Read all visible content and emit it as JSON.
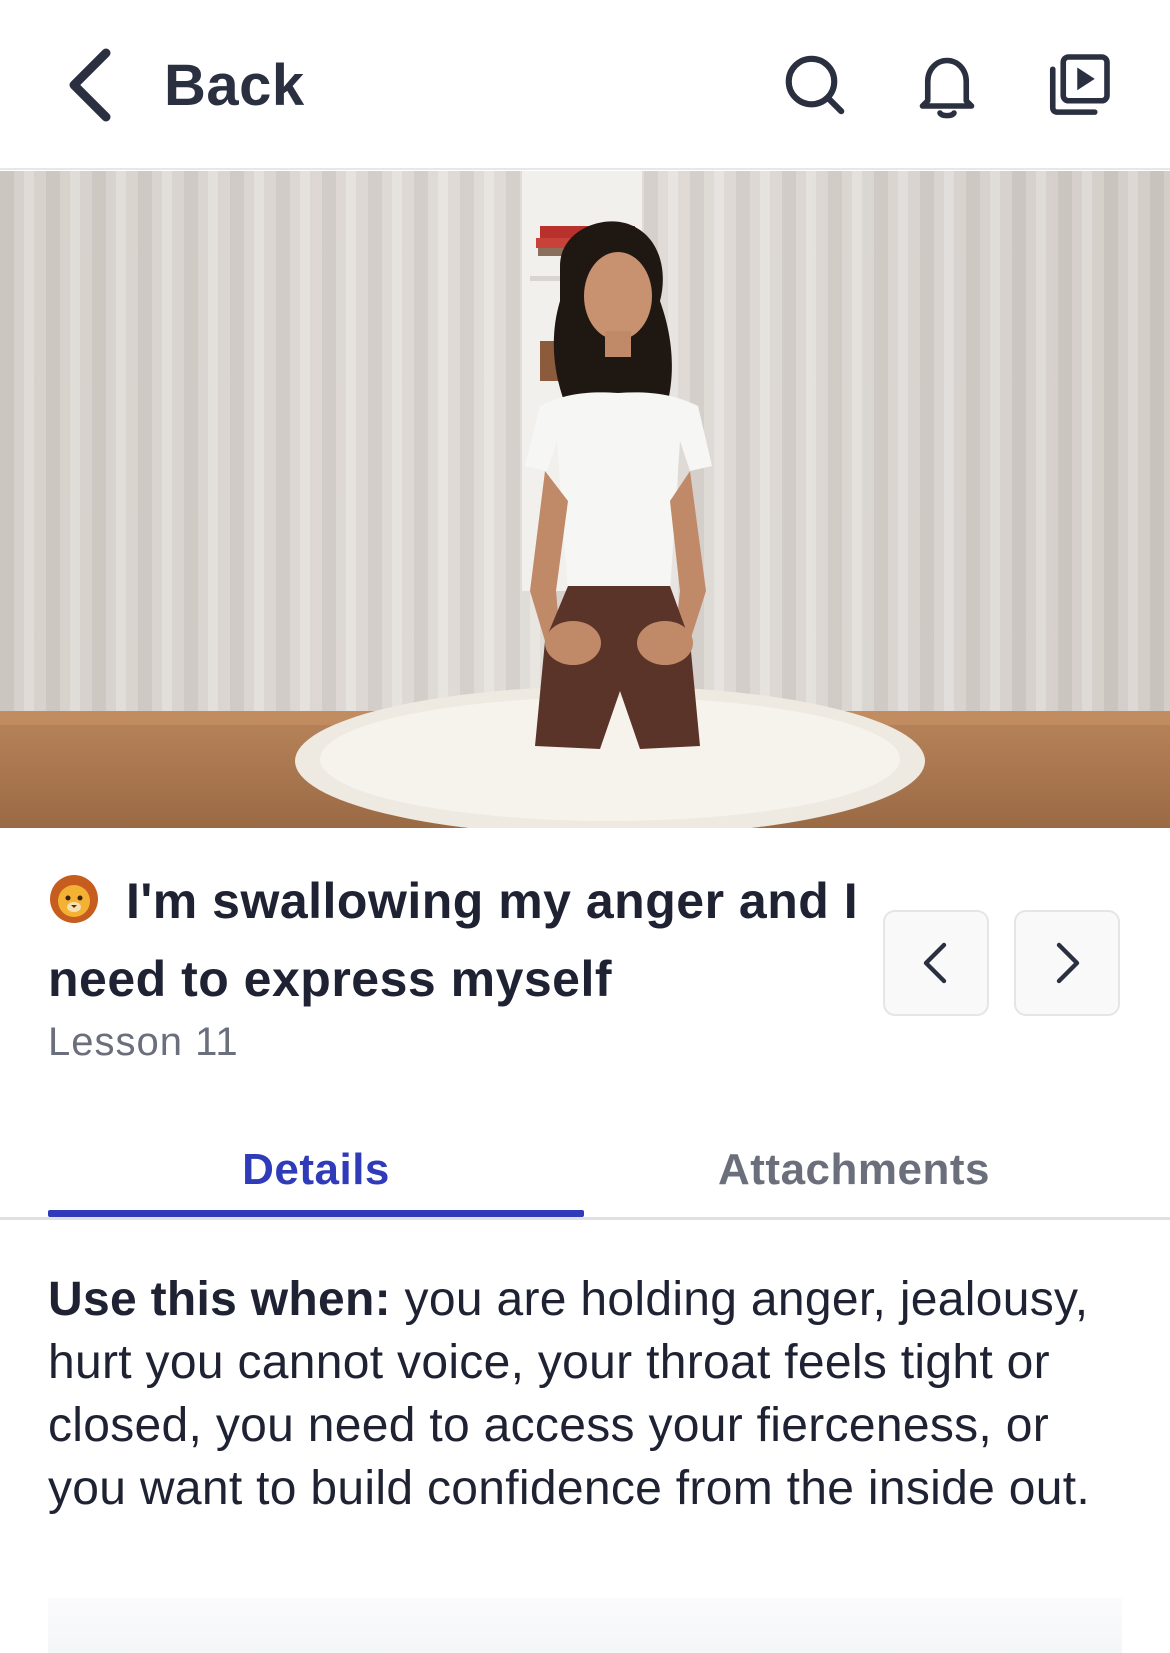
{
  "header": {
    "back_label": "Back",
    "icons": [
      "search-icon",
      "bell-icon",
      "video-library-icon"
    ]
  },
  "lesson": {
    "emoji": "lion-face",
    "title": "I'm swallowing my anger and I need to express myself",
    "number_label": "Lesson 11"
  },
  "tabs": {
    "details": "Details",
    "attachments": "Attachments",
    "active": "Details"
  },
  "details": {
    "lead": "Use this when:",
    "text": " you are holding anger, jealousy, hurt you cannot voice, your throat feels tight or closed, you need to access your fierceness, or you want to build confidence from the inside out."
  },
  "colors": {
    "accent": "#2f3bb8",
    "text": "#1e2233",
    "muted": "#6a6f7b"
  }
}
